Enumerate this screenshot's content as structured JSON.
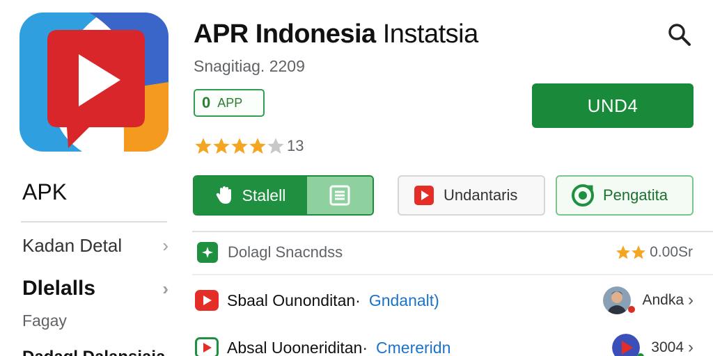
{
  "app": {
    "title_bold": "APR Indonesia",
    "title_light": "Instatsia",
    "subtitle": "Snagitiag. 2209",
    "badge_icon": "0",
    "badge_text": "APP",
    "install_label": "UND4",
    "rating_stars": 4,
    "rating_count": "13",
    "brand_green": "#198a39",
    "brand_red": "#e52d27"
  },
  "sidebar": {
    "heading": "APK",
    "items": [
      {
        "label": "Kadan Detal",
        "chevron": "›"
      },
      {
        "label": "Dlelalls",
        "chevron": "›"
      }
    ],
    "sub_label": "Fagay",
    "cut_label": "Dadagl Dalansiaia"
  },
  "actions": {
    "install_label": "Stalell",
    "uninstall_label": "Undantaris",
    "settings_label": "Pengatita"
  },
  "details": {
    "label": "Dolagl Snacndss",
    "rating_value": "0.00Sr",
    "rating_stars": 2
  },
  "list": [
    {
      "title": "Sbaal Ounonditan·",
      "link": "Gndanalt)",
      "trail_text": "Andka",
      "chevron": "›",
      "trail_icon": "avatar"
    },
    {
      "title": "Absal Uooneriditan·",
      "link": "Cmereridn",
      "trail_text": "3004",
      "chevron": "›",
      "trail_icon": "play-badge"
    }
  ],
  "icons": {
    "search": "search-icon",
    "app_logo": "play-logo-icon",
    "star": "star-icon",
    "hand": "hand-icon",
    "list": "list-icon",
    "play": "play-icon",
    "settings": "circle-target-icon"
  }
}
